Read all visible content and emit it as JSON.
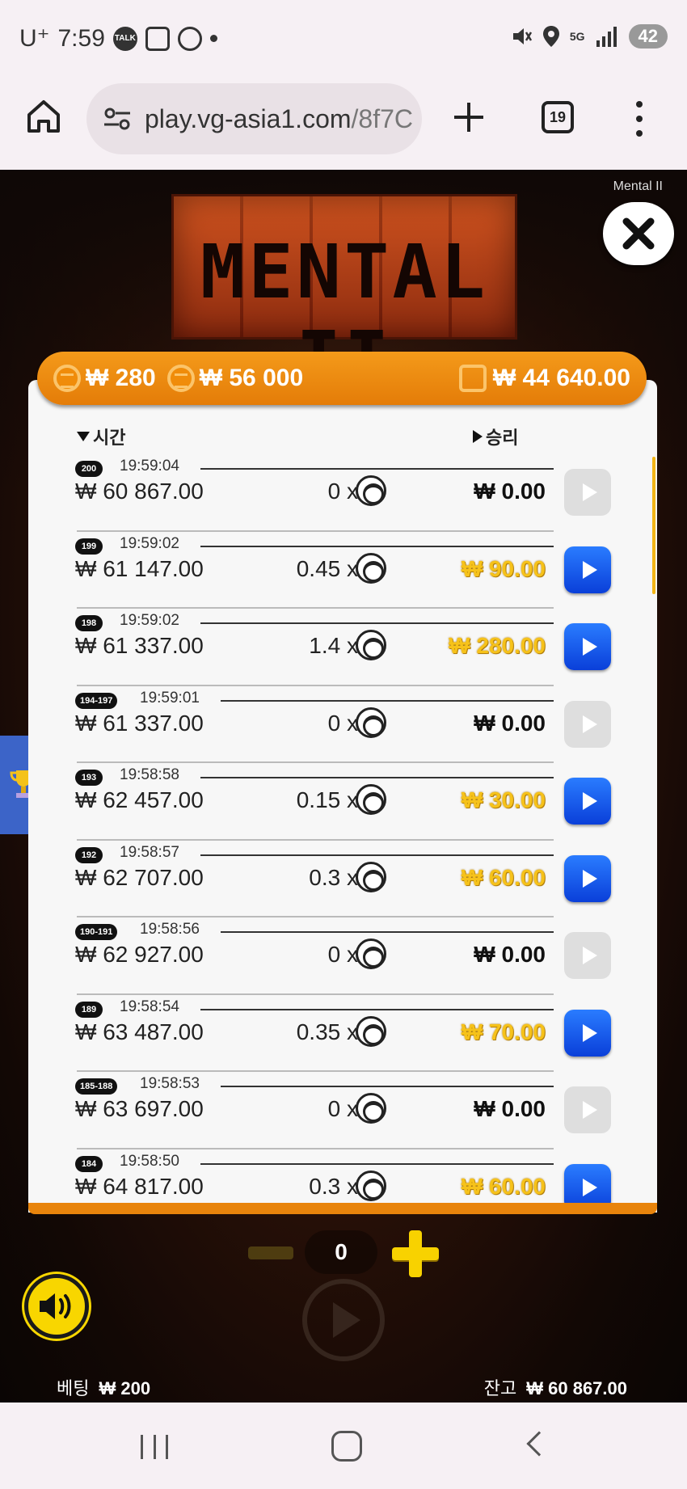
{
  "status_bar": {
    "carrier": "U⁺",
    "time": "7:59",
    "talk_label": "TALK",
    "network": "5G",
    "battery": "42"
  },
  "browser": {
    "url_host": "play.vg-asia1.com",
    "url_path": "/8f7C",
    "tab_count": "19"
  },
  "game": {
    "title": "Mental II",
    "logo_text": "MENTAL II",
    "header": {
      "bet_value": "₩ 280",
      "max_win": "₩ 56 000",
      "wallet": "₩ 44 640.00"
    },
    "columns": {
      "time": "시간",
      "win": "승리"
    },
    "rows": [
      {
        "id": "200",
        "time": "19:59:04",
        "balance": "₩ 60 867.00",
        "multiplier": "0 x",
        "win": "₩ 0.00",
        "highlight": false,
        "replay": false
      },
      {
        "id": "199",
        "time": "19:59:02",
        "balance": "₩ 61 147.00",
        "multiplier": "0.45 x",
        "win": "₩ 90.00",
        "highlight": true,
        "replay": true
      },
      {
        "id": "198",
        "time": "19:59:02",
        "balance": "₩ 61 337.00",
        "multiplier": "1.4 x",
        "win": "₩ 280.00",
        "highlight": true,
        "replay": true
      },
      {
        "id": "194-197",
        "time": "19:59:01",
        "balance": "₩ 61 337.00",
        "multiplier": "0 x",
        "win": "₩ 0.00",
        "highlight": false,
        "replay": false
      },
      {
        "id": "193",
        "time": "19:58:58",
        "balance": "₩ 62 457.00",
        "multiplier": "0.15 x",
        "win": "₩ 30.00",
        "highlight": true,
        "replay": true
      },
      {
        "id": "192",
        "time": "19:58:57",
        "balance": "₩ 62 707.00",
        "multiplier": "0.3 x",
        "win": "₩ 60.00",
        "highlight": true,
        "replay": true
      },
      {
        "id": "190-191",
        "time": "19:58:56",
        "balance": "₩ 62 927.00",
        "multiplier": "0 x",
        "win": "₩ 0.00",
        "highlight": false,
        "replay": false
      },
      {
        "id": "189",
        "time": "19:58:54",
        "balance": "₩ 63 487.00",
        "multiplier": "0.35 x",
        "win": "₩ 70.00",
        "highlight": true,
        "replay": true
      },
      {
        "id": "185-188",
        "time": "19:58:53",
        "balance": "₩ 63 697.00",
        "multiplier": "0 x",
        "win": "₩ 0.00",
        "highlight": false,
        "replay": false
      },
      {
        "id": "184",
        "time": "19:58:50",
        "balance": "₩ 64 817.00",
        "multiplier": "0.3 x",
        "win": "₩ 60.00",
        "highlight": true,
        "replay": true
      }
    ],
    "controls": {
      "bet_steps": "0"
    },
    "footer": {
      "bet_label": "베팅",
      "bet_amount": "₩ 200",
      "balance_label": "잔고",
      "balance_amount": "₩ 60 867.00"
    }
  },
  "colors": {
    "accent_orange": "#ee8a10",
    "win_gold": "#f6c21a",
    "replay_blue": "#1a5cf0",
    "sound_yellow": "#f8d600"
  }
}
